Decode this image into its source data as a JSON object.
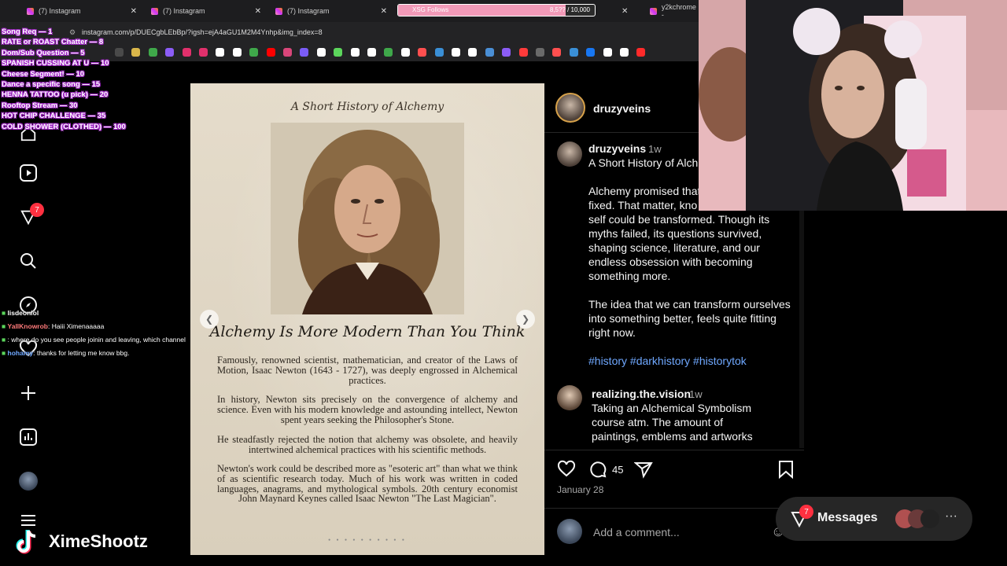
{
  "browser": {
    "tabs": [
      {
        "title": "(7) Instagram"
      },
      {
        "title": "(7) Instagram"
      },
      {
        "title": "(7) Instagram"
      },
      {
        "title": "y2kchrome -"
      }
    ],
    "url": "instagram.com/p/DUECgbLEbBp/?igsh=ejA4aGU1M2M4Ynhp&img_index=8"
  },
  "follow_goal": {
    "label": "XSG Follows",
    "count": "8,5?? / 10,000",
    "progress": 0.85,
    "color": "#f29ab8"
  },
  "stream_commands": [
    "Song Req — 1",
    "RATE or ROAST Chatter — 8",
    "Dom/Sub Question — 5",
    "SPANISH CUSSING AT U — 10",
    "Cheese Segment! — 10",
    "Dance a specific song — 15",
    "HENNA TATTOO (u pick) — 20",
    "Rooftop Stream — 30",
    "HOT CHIP CHALLENGE — 35",
    "COLD SHOWER (CLOTHED) — 100"
  ],
  "chat": [
    {
      "user": "lisdeonlol",
      "message": "",
      "color": "#ffffff"
    },
    {
      "user": "YallKnowrob",
      "message": ": Haiii Ximenaaaaa",
      "color": "#ff7a7a"
    },
    {
      "user": "",
      "message": ": where do you see people joinin and leaving, which channel",
      "color": "#6fa8ff"
    },
    {
      "user": "hohamy",
      "message": ": thanks for letting me know bbg.",
      "color": "#6fa8ff"
    }
  ],
  "sidebar": {
    "notification_badge": "7",
    "icons": [
      "home-icon",
      "reels-icon",
      "notifications-icon",
      "search-icon",
      "explore-icon",
      "heart-icon",
      "create-icon",
      "dashboard-icon",
      "profile-icon"
    ]
  },
  "post_image": {
    "title": "A Short History of Alchemy",
    "heading": "Alchemy Is More Modern Than You Think",
    "paragraphs": [
      "Famously, renowned scientist, mathematician, and creator of the Laws of Motion, Isaac Newton (1643 - 1727), was deeply engrossed in Alchemical practices.",
      "In history, Newton sits precisely on the convergence of alchemy and science. Even with his modern knowledge and astounding intellect, Newton spent years seeking the Philosopher's Stone.",
      "He steadfastly rejected the notion that alchemy was obsolete, and heavily intertwined alchemical practices with his scientific methods.",
      "Newton's work could be described more as \"esoteric art\" than what we think of as scientific research today. Much of his work was written in coded languages, anagrams, and mythological symbols. 20th century economist John Maynard Keynes called Isaac Newton \"The Last Magician\"."
    ]
  },
  "post": {
    "author": "druzyveins",
    "caption_time": "1w",
    "caption_title": "A Short History of Alch",
    "caption_lines_1": [
      "Alchemy promised that",
      "fixed. That matter, kno"
    ],
    "caption_lines_2": [
      "self could be transformed. Though its",
      "myths failed, its questions survived,",
      "shaping science, literature, and our",
      "endless obsession with becoming",
      "something more."
    ],
    "caption_lines_3": [
      "The idea that we can transform ourselves",
      "into something better, feels quite fitting",
      "right now."
    ],
    "hashtags": "#history #darkhistory #historytok",
    "comment": {
      "user": "realizing.the.vision",
      "time": "1w",
      "lines": [
        "Taking an Alchemical Symbolism",
        "course atm. The amount of",
        "paintings, emblems and artworks"
      ]
    },
    "comment_count": "45",
    "date": "January 28",
    "add_comment_placeholder": "Add a comment..."
  },
  "messages": {
    "label": "Messages",
    "badge": "7"
  },
  "watermark": "XimeShootz"
}
